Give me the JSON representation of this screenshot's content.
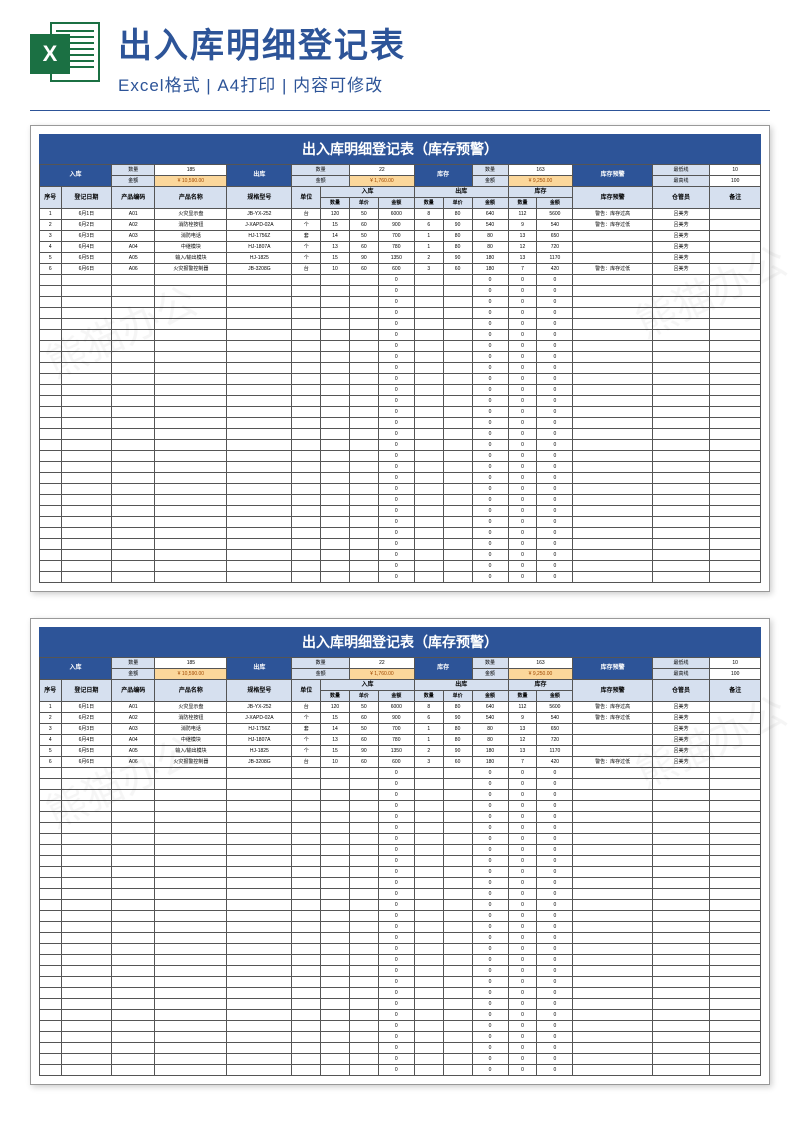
{
  "header": {
    "icon_letter": "X",
    "title": "出入库明细登记表",
    "subtitle": "Excel格式 | A4打印 | 内容可修改"
  },
  "watermark": "熊猫办公",
  "sheet": {
    "title": "出入库明细登记表（库存预警）",
    "summary": {
      "in_label": "入库",
      "in_qty_lbl": "数量",
      "in_qty": "185",
      "in_amt_lbl": "金额",
      "in_amt": "¥ 10,590.00",
      "out_label": "出库",
      "out_qty_lbl": "数量",
      "out_qty": "22",
      "out_amt_lbl": "金额",
      "out_amt": "¥ 1,760.00",
      "stk_label": "库存",
      "stk_qty_lbl": "数量",
      "stk_qty": "163",
      "stk_amt_lbl": "金额",
      "stk_amt": "¥ 9,250.00",
      "warn_label": "库存预警",
      "min_lbl": "最低线",
      "min": "10",
      "max_lbl": "最高线",
      "max": "100"
    },
    "groups": {
      "in": "入库",
      "out": "出库",
      "stk": "库存"
    },
    "cols": {
      "seq": "序号",
      "date": "登记日期",
      "code": "产品编码",
      "name": "产品名称",
      "spec": "规格型号",
      "unit": "单位",
      "qty": "数量",
      "price": "单价",
      "amt": "金额",
      "warn": "库存预警",
      "keeper": "仓管员",
      "note": "备注"
    },
    "rows": [
      {
        "seq": "1",
        "date": "6月1日",
        "code": "A01",
        "name": "火灾显示盘",
        "spec": "JB-YX-252",
        "unit": "台",
        "iq": "120",
        "ip": "50",
        "ia": "6000",
        "oq": "8",
        "op": "80",
        "oa": "640",
        "sq": "112",
        "sa": "5600",
        "warn": "警告：库存过高",
        "keeper": "吕美芳",
        "note": ""
      },
      {
        "seq": "2",
        "date": "6月2日",
        "code": "A02",
        "name": "消防栓按钮",
        "spec": "J-XAPD-02A",
        "unit": "个",
        "iq": "15",
        "ip": "60",
        "ia": "900",
        "oq": "6",
        "op": "90",
        "oa": "540",
        "sq": "9",
        "sa": "540",
        "warn": "警告：库存过低",
        "keeper": "吕美芳",
        "note": ""
      },
      {
        "seq": "3",
        "date": "6月3日",
        "code": "A03",
        "name": "消防电话",
        "spec": "HJ-1756Z",
        "unit": "套",
        "iq": "14",
        "ip": "50",
        "ia": "700",
        "oq": "1",
        "op": "80",
        "oa": "80",
        "sq": "13",
        "sa": "650",
        "warn": "",
        "keeper": "吕美芳",
        "note": ""
      },
      {
        "seq": "4",
        "date": "6月4日",
        "code": "A04",
        "name": "中继模块",
        "spec": "HJ-1807A",
        "unit": "个",
        "iq": "13",
        "ip": "60",
        "ia": "780",
        "oq": "1",
        "op": "80",
        "oa": "80",
        "sq": "12",
        "sa": "720",
        "warn": "",
        "keeper": "吕美芳",
        "note": ""
      },
      {
        "seq": "5",
        "date": "6月5日",
        "code": "A05",
        "name": "输入/输出模块",
        "spec": "HJ-1825",
        "unit": "个",
        "iq": "15",
        "ip": "90",
        "ia": "1350",
        "oq": "2",
        "op": "90",
        "oa": "180",
        "sq": "13",
        "sa": "1170",
        "warn": "",
        "keeper": "吕美芳",
        "note": ""
      },
      {
        "seq": "6",
        "date": "6月6日",
        "code": "A06",
        "name": "火灾报警控制器",
        "spec": "JB-3208G",
        "unit": "台",
        "iq": "10",
        "ip": "60",
        "ia": "600",
        "oq": "3",
        "op": "60",
        "oa": "180",
        "sq": "7",
        "sa": "420",
        "warn": "警告：库存过低",
        "keeper": "吕美芳",
        "note": ""
      }
    ],
    "empty_rows": 28
  }
}
